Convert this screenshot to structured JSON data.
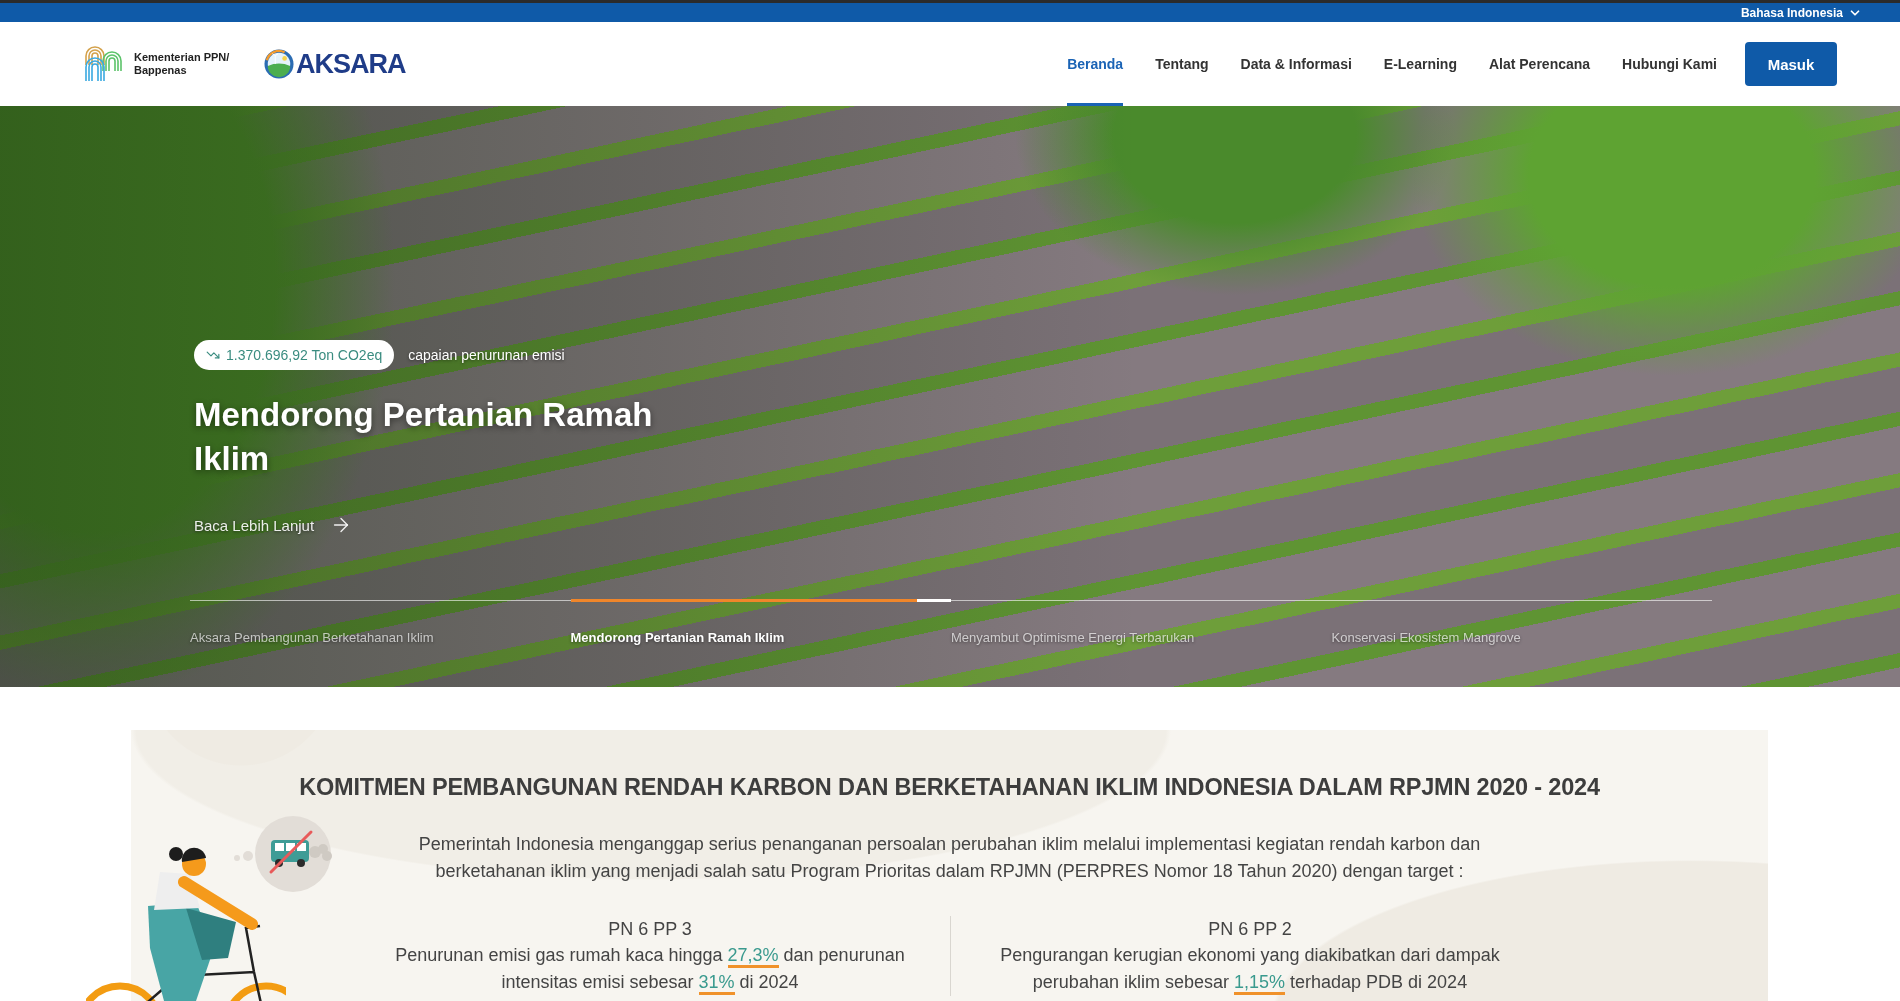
{
  "top_bar": {
    "language": "Bahasa Indonesia"
  },
  "header": {
    "ministry": "Kementerian PPN/ Bappenas",
    "brand": "AKSARA",
    "nav": [
      {
        "label": "Beranda",
        "selected": true
      },
      {
        "label": "Tentang",
        "selected": false
      },
      {
        "label": "Data & Informasi",
        "selected": false
      },
      {
        "label": "E-Learning",
        "selected": false
      },
      {
        "label": "Alat Perencana",
        "selected": false
      },
      {
        "label": "Hubungi Kami",
        "selected": false
      }
    ],
    "login_button": "Masuk"
  },
  "hero": {
    "stat": "1.370.696,92 Ton CO2eq",
    "stat_caption": "capaian penurunan emisi",
    "title": "Mendorong Pertanian Ramah Iklim",
    "link": "Baca Lebih Lanjut"
  },
  "slides": [
    {
      "label": "Aksara Pembangunan Berketahanan Iklim",
      "selected": false
    },
    {
      "label": "Mendorong Pertanian Ramah Iklim",
      "selected": true,
      "level": 0.91
    },
    {
      "label": "Menyambut Optimisme Energi Terbarukan",
      "selected": false
    },
    {
      "label": "Konservasi Ekosistem Mangrove",
      "selected": false
    }
  ],
  "commitment": {
    "title": "KOMITMEN PEMBANGUNAN RENDAH KARBON DAN BERKETAHANAN IKLIM INDONESIA DALAM RPJMN 2020 - 2024",
    "intro": "Pemerintah Indonesia menganggap serius penanganan persoalan perubahan iklim melalui implementasi kegiatan rendah karbon dan berketahanan iklim yang menjadi salah satu Program Prioritas dalam RPJMN (PERPRES Nomor 18 Tahun 2020) dengan target :",
    "targets": [
      {
        "code": "PN 6 PP 3",
        "text": "Penurunan emisi gas rumah kaca hingga **27,3%** dan penurunan intensitas emisi sebesar **31%** di 2024"
      },
      {
        "code": "PN 6 PP 2",
        "text": "Pengurangan kerugian ekonomi yang diakibatkan dari dampak perubahan iklim sebesar **1,15%** terhadap PDB di 2024"
      }
    ]
  }
}
